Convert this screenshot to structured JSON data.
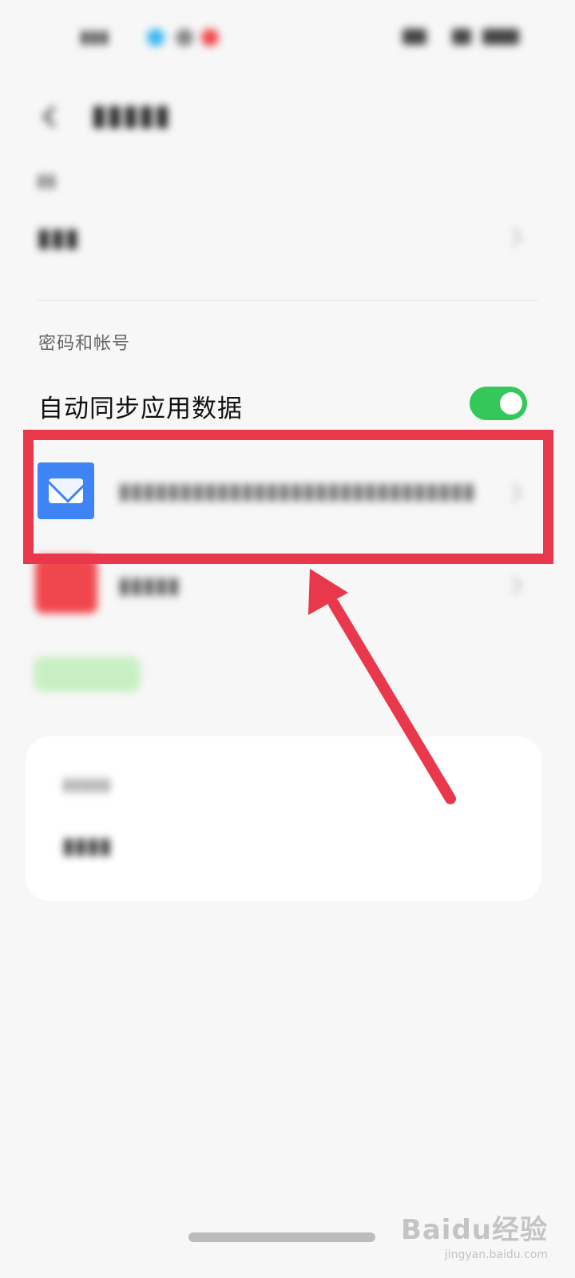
{
  "settings": {
    "section_label": "密码和帐号",
    "sync_label": "自动同步应用数据",
    "sync_enabled": true
  },
  "watermark": {
    "main": "Baidu经验",
    "sub": "jingyan.baidu.com"
  },
  "colors": {
    "toggle_on": "#34c759",
    "highlight": "#e9384c",
    "mail_icon": "#3e84f5",
    "app_icon_red": "#f0474d"
  },
  "icons": {
    "back": "back-arrow-icon",
    "mail": "mail-icon",
    "chevron": "chevron-right-icon"
  }
}
